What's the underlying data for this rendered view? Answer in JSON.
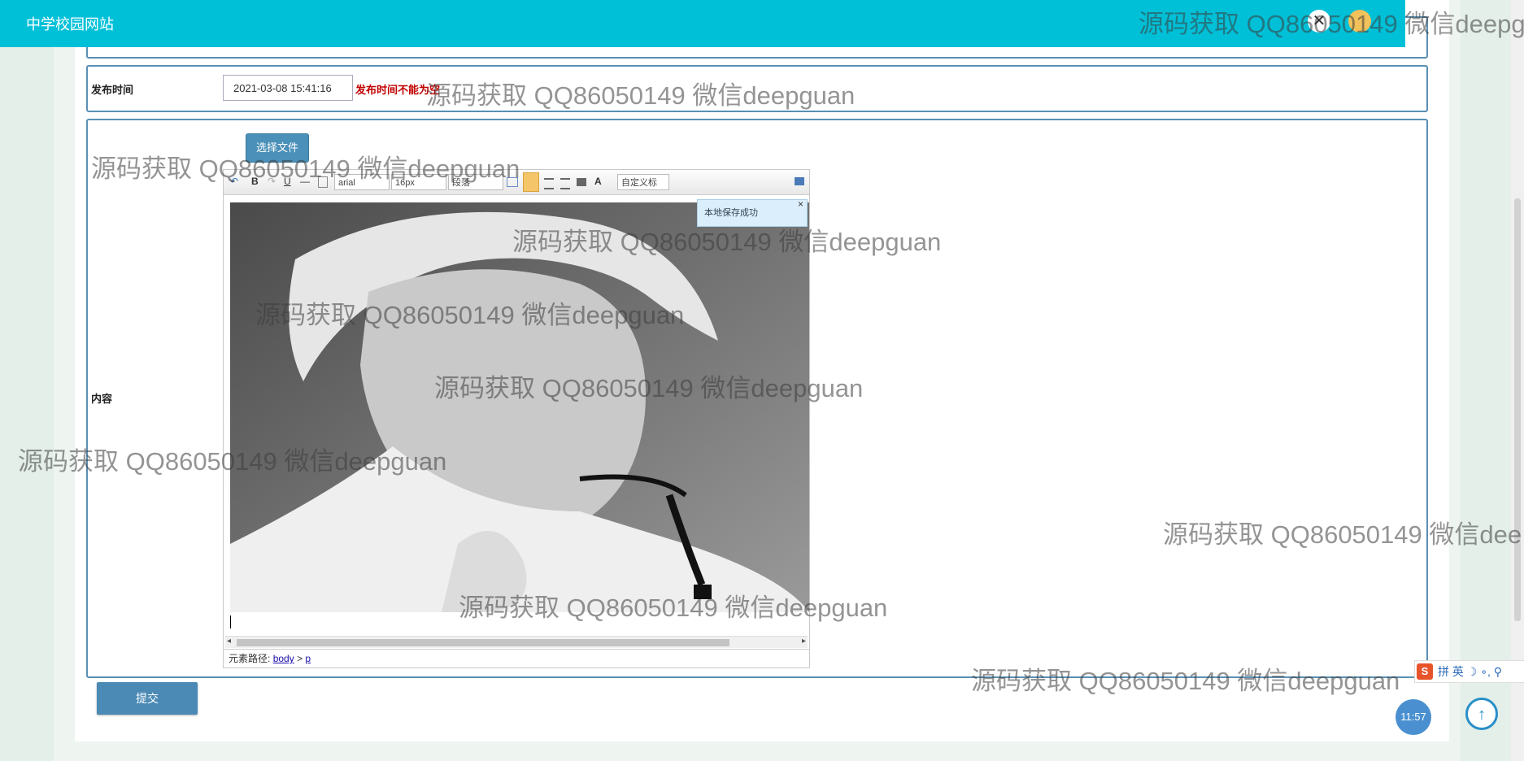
{
  "header": {
    "site_title": "中学校园网站",
    "close_glyph": "✕",
    "avatar_color": "#f1c15a"
  },
  "form": {
    "publish_time": {
      "label": "发布时间",
      "value": "2021-03-08 15:41:16",
      "error": "发布时间不能为空"
    },
    "content": {
      "label": "内容",
      "file_button": "选择文件"
    },
    "submit_label": "提交"
  },
  "editor": {
    "font_family": "arial",
    "font_size": "16px",
    "paragraph": "段落",
    "custom_title": "自定义标",
    "save_tip": "本地保存成功",
    "save_tip_close": "×",
    "path_label": "元素路径:",
    "path_items": [
      "body",
      "p"
    ],
    "path_sep": ">",
    "toolbar_glyphs": {
      "undo": "↶",
      "bold": "B",
      "redo": "↷",
      "underline": "U",
      "hr": "—",
      "fontcolor": "A"
    }
  },
  "ime": {
    "labels": "拼 英 ☽ ∘, ⚲",
    "logo": "S"
  },
  "clock": {
    "time": "11:57"
  },
  "scroll_up_glyph": "↑",
  "watermarks": [
    "源码获取 QQ86050149 微信deepg",
    "源码获取 QQ86050149 微信deepguan",
    "源码获取 QQ86050149 微信deepguan",
    "源码获取 QQ86050149 微信deepguan",
    "源码获取 QQ86050149 微信deepguan",
    "源码获取 QQ86050149 微信deepguan",
    "源码获取 QQ86050149 微信deepguan",
    "源码获取 QQ86050149 微信dee",
    "源码获取 QQ86050149 微信deepguan",
    "源码获取 QQ86050149 微信deepguan"
  ]
}
